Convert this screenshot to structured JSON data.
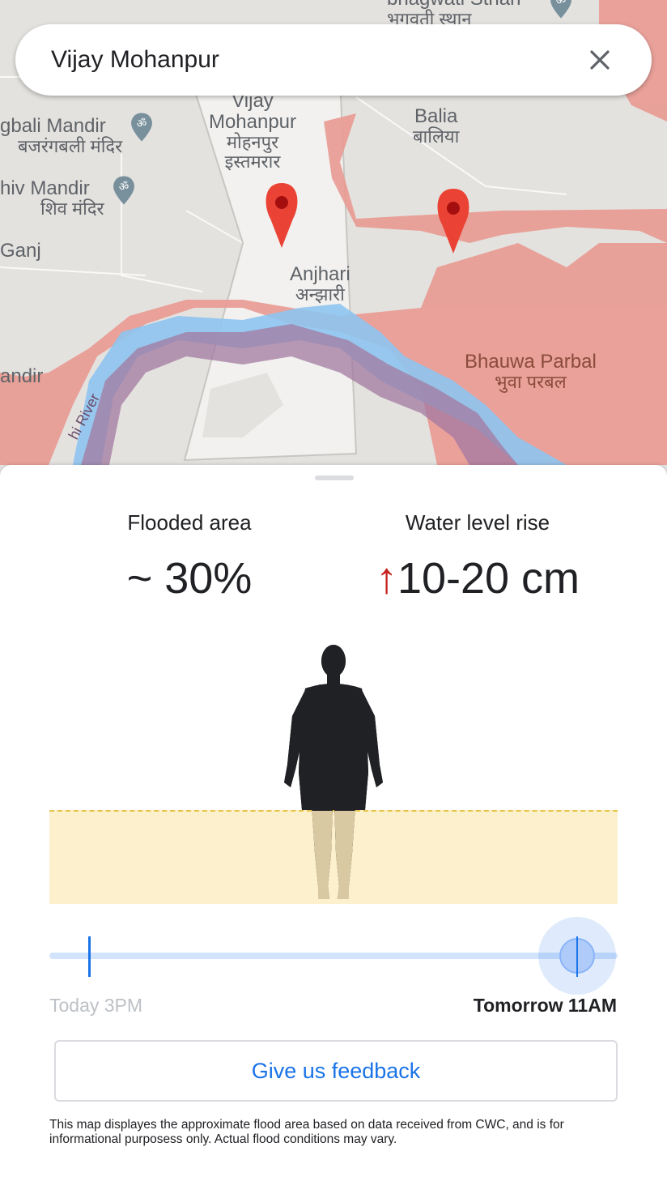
{
  "search": {
    "value": "Vijay Mohanpur",
    "close_icon": "close-icon"
  },
  "map": {
    "labels": [
      {
        "key": "top_partial",
        "text": "bhagwati Sthan",
        "sub": "भगवती स्थान"
      },
      {
        "key": "bajrangbali",
        "text": "gbali Mandir",
        "sub": "बजरंगबली मंदिर"
      },
      {
        "key": "shiv",
        "text": "hiv Mandir",
        "sub": "शिव मंदिर"
      },
      {
        "key": "ganj",
        "text": "Ganj",
        "sub": ""
      },
      {
        "key": "vijay",
        "text": "Vijay Mohanpur",
        "sub": "मोहनपुर इस्तमरार"
      },
      {
        "key": "balia",
        "text": "Balia",
        "sub": "बालिया"
      },
      {
        "key": "anjhari",
        "text": "Anjhari",
        "sub": "अन्झारी"
      },
      {
        "key": "andir",
        "text": "andir",
        "sub": ""
      },
      {
        "key": "bhauwa",
        "text": "Bhauwa Parbal",
        "sub": "भुवा परबल"
      },
      {
        "key": "river",
        "text": "hi River",
        "sub": ""
      }
    ],
    "colors": {
      "land": "#e4e2df",
      "flood": "#e99a92",
      "river": "#8ec4ef",
      "overlap": "#a37aa0",
      "selected_area": "#f2f1ef",
      "pin": "#ea4335"
    }
  },
  "stats": {
    "flooded_label": "Flooded area",
    "flooded_value": "~ 30%",
    "water_label": "Water level rise",
    "water_arrow": "↑",
    "water_value": "10-20 cm"
  },
  "timeline": {
    "start_label": "Today 3PM",
    "end_label": "Tomorrow 11AM",
    "position": 0.93
  },
  "feedback_label": "Give us feedback",
  "disclaimer": "This map displayes the approximate flood area based on data received from CWC, and is for informational purposess only. Actual flood conditions may vary."
}
